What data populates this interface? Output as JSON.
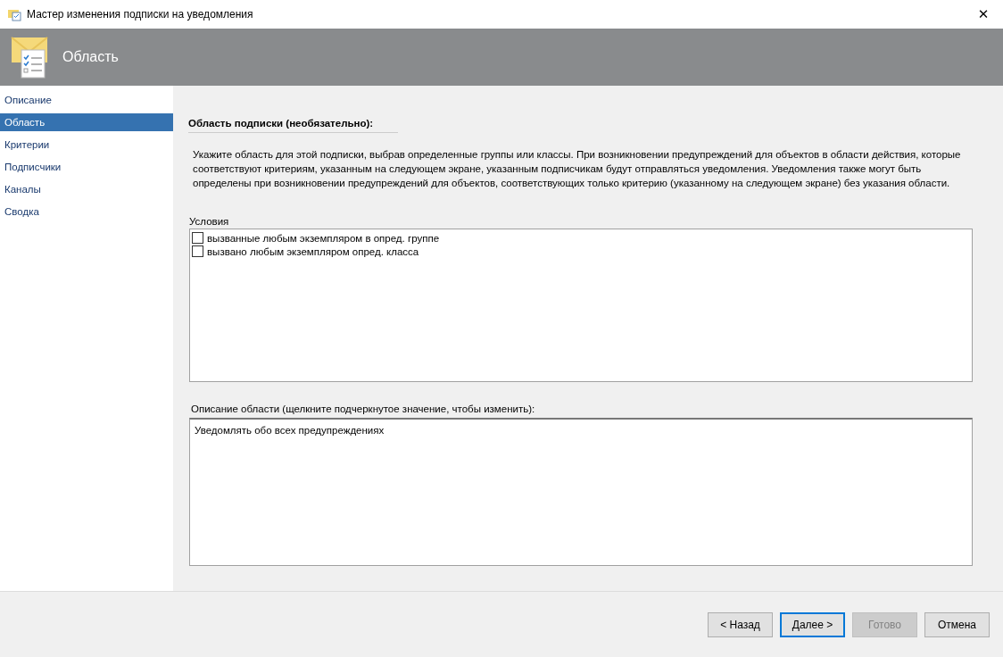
{
  "window": {
    "title": "Мастер изменения подписки на уведомления",
    "close": "✕"
  },
  "header": {
    "title": "Область"
  },
  "sidebar": {
    "items": [
      {
        "label": "Описание",
        "selected": false
      },
      {
        "label": "Область",
        "selected": true
      },
      {
        "label": "Критерии",
        "selected": false
      },
      {
        "label": "Подписчики",
        "selected": false
      },
      {
        "label": "Каналы",
        "selected": false
      },
      {
        "label": "Сводка",
        "selected": false
      }
    ]
  },
  "section": {
    "heading": "Область подписки (необязательно):",
    "description": "Укажите область для этой подписки, выбрав определенные группы или классы. При возникновении предупреждений для объектов в области действия, которые соответствуют критериям, указанным на следующем экране, указанным подписчикам будут отправляться уведомления. Уведомления также могут быть определены при возникновении предупреждений для объектов, соответствующих только критерию (указанному на следующем экране) без указания области."
  },
  "conditions": {
    "label": "Условия",
    "items": [
      {
        "label": "вызванные любым экземпляром в опред. группе",
        "checked": false
      },
      {
        "label": "вызвано любым экземпляром опред. класса",
        "checked": false
      }
    ]
  },
  "scope_description": {
    "label": "Описание области (щелкните подчеркнутое значение, чтобы изменить):",
    "text": "Уведомлять обо всех предупреждениях"
  },
  "buttons": [
    {
      "label": "< Назад",
      "disabled": false,
      "default": false
    },
    {
      "label": "Далее >",
      "disabled": false,
      "default": true
    },
    {
      "label": "Готово",
      "disabled": true,
      "default": false
    },
    {
      "label": "Отмена",
      "disabled": false,
      "default": false
    }
  ]
}
